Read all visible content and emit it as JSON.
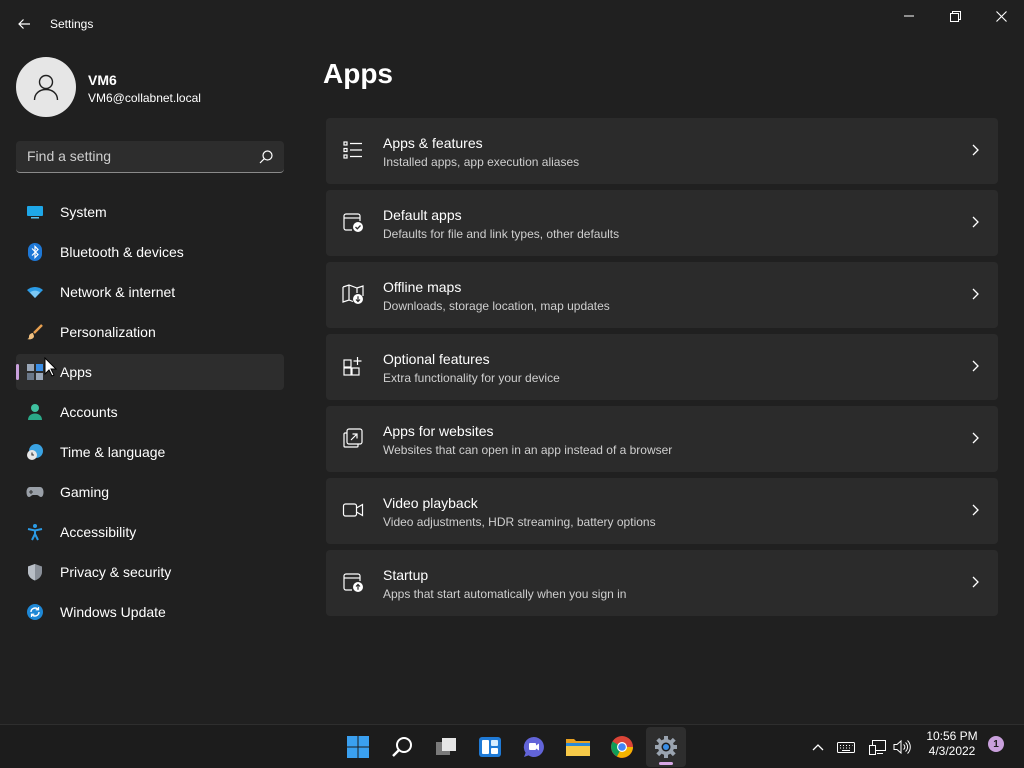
{
  "window": {
    "title": "Settings",
    "controls": {
      "minimize": "minimize-icon",
      "maximize": "maximize-icon",
      "close": "close-icon"
    }
  },
  "profile": {
    "name": "VM6",
    "email": "VM6@collabnet.local"
  },
  "search": {
    "placeholder": "Find a setting"
  },
  "sidebar": {
    "items": [
      {
        "label": "System",
        "icon": "display-icon"
      },
      {
        "label": "Bluetooth & devices",
        "icon": "bluetooth-icon"
      },
      {
        "label": "Network & internet",
        "icon": "wifi-icon"
      },
      {
        "label": "Personalization",
        "icon": "brush-icon"
      },
      {
        "label": "Apps",
        "icon": "apps-icon",
        "active": true
      },
      {
        "label": "Accounts",
        "icon": "person-icon"
      },
      {
        "label": "Time & language",
        "icon": "globe-clock-icon"
      },
      {
        "label": "Gaming",
        "icon": "gamepad-icon"
      },
      {
        "label": "Accessibility",
        "icon": "accessibility-icon"
      },
      {
        "label": "Privacy & security",
        "icon": "shield-icon"
      },
      {
        "label": "Windows Update",
        "icon": "update-icon"
      }
    ]
  },
  "main": {
    "title": "Apps",
    "cards": [
      {
        "title": "Apps & features",
        "subtitle": "Installed apps, app execution aliases",
        "icon": "list-icon"
      },
      {
        "title": "Default apps",
        "subtitle": "Defaults for file and link types, other defaults",
        "icon": "default-apps-icon"
      },
      {
        "title": "Offline maps",
        "subtitle": "Downloads, storage location, map updates",
        "icon": "map-icon"
      },
      {
        "title": "Optional features",
        "subtitle": "Extra functionality for your device",
        "icon": "add-grid-icon"
      },
      {
        "title": "Apps for websites",
        "subtitle": "Websites that can open in an app instead of a browser",
        "icon": "open-link-icon"
      },
      {
        "title": "Video playback",
        "subtitle": "Video adjustments, HDR streaming, battery options",
        "icon": "video-icon"
      },
      {
        "title": "Startup",
        "subtitle": "Apps that start automatically when you sign in",
        "icon": "startup-icon"
      }
    ]
  },
  "taskbar": {
    "apps": [
      "start-icon",
      "search-icon",
      "task-view-icon",
      "widgets-icon",
      "teams-chat-icon",
      "file-explorer-icon",
      "chrome-icon",
      "settings-icon"
    ],
    "active_app": "settings-icon",
    "tray": [
      "chevron-up-icon",
      "keyboard-icon",
      "network-icon",
      "volume-icon"
    ],
    "time": "10:56 PM",
    "date": "4/3/2022",
    "notification_count": "1"
  },
  "colors": {
    "background": "#202020",
    "card": "#2b2b2b",
    "accent": "#c9a0dc",
    "taskbar": "#1c1c1c"
  }
}
